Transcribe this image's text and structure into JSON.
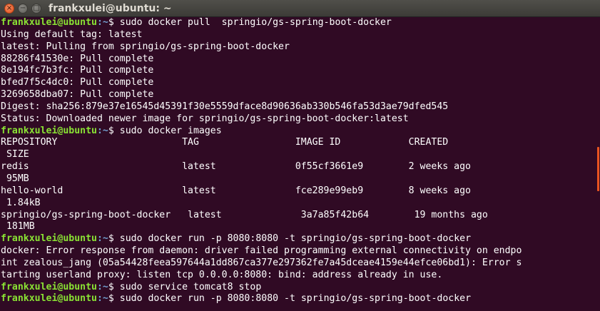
{
  "window": {
    "title": "frankxulei@ubuntu: ~",
    "buttons": {
      "close": "×",
      "minimize": "−",
      "maximize": "□"
    },
    "colors": {
      "background": "#300a24",
      "prompt_user": "#8ae234",
      "prompt_path": "#729fcf",
      "text": "#ffffff",
      "close": "#e2531f"
    }
  },
  "terminal": {
    "lines": [
      {
        "prompt": {
          "user": "frankxulei@ubuntu",
          "path": ":~",
          "dollar": "$ "
        },
        "text": "sudo docker pull  springio/gs-spring-boot-docker"
      },
      {
        "text": "Using default tag: latest"
      },
      {
        "text": "latest: Pulling from springio/gs-spring-boot-docker"
      },
      {
        "text": "88286f41530e: Pull complete"
      },
      {
        "text": "8e194fc7b3fc: Pull complete"
      },
      {
        "text": "bfed7f5c4dc0: Pull complete"
      },
      {
        "text": "3269658dba07: Pull complete"
      },
      {
        "text": "Digest: sha256:879e37e16545d45391f30e5559dface8d90636ab330b546fa53d3ae79dfed545"
      },
      {
        "text": "Status: Downloaded newer image for springio/gs-spring-boot-docker:latest"
      },
      {
        "prompt": {
          "user": "frankxulei@ubuntu",
          "path": ":~",
          "dollar": "$ "
        },
        "text": "sudo docker images"
      },
      {
        "text": "REPOSITORY                      TAG                 IMAGE ID            CREATED"
      },
      {
        "text": " SIZE"
      },
      {
        "text": "redis                           latest              0f55cf3661e9        2 weeks ago"
      },
      {
        "text": " 95MB"
      },
      {
        "text": "hello-world                     latest              fce289e99eb9        8 weeks ago"
      },
      {
        "text": " 1.84kB"
      },
      {
        "text": "springio/gs-spring-boot-docker   latest              3a7a85f42b64        19 months ago"
      },
      {
        "text": " 181MB"
      },
      {
        "prompt": {
          "user": "frankxulei@ubuntu",
          "path": ":~",
          "dollar": "$ "
        },
        "text": "sudo docker run -p 8080:8080 -t springio/gs-spring-boot-docker"
      },
      {
        "text": "docker: Error response from daemon: driver failed programming external connectivity on endpo"
      },
      {
        "text": "int zealous_jang (05a54428feea597644a1dd867ca377e297362fe7a45dceae4159e44efce06bd1): Error s"
      },
      {
        "text": "tarting userland proxy: listen tcp 0.0.0.0:8080: bind: address already in use."
      },
      {
        "prompt": {
          "user": "frankxulei@ubuntu",
          "path": ":~",
          "dollar": "$ "
        },
        "text": "sudo service tomcat8 stop"
      },
      {
        "prompt": {
          "user": "frankxulei@ubuntu",
          "path": ":~",
          "dollar": "$ "
        },
        "text": "sudo docker run -p 8080:8080 -t springio/gs-spring-boot-docker"
      }
    ]
  }
}
